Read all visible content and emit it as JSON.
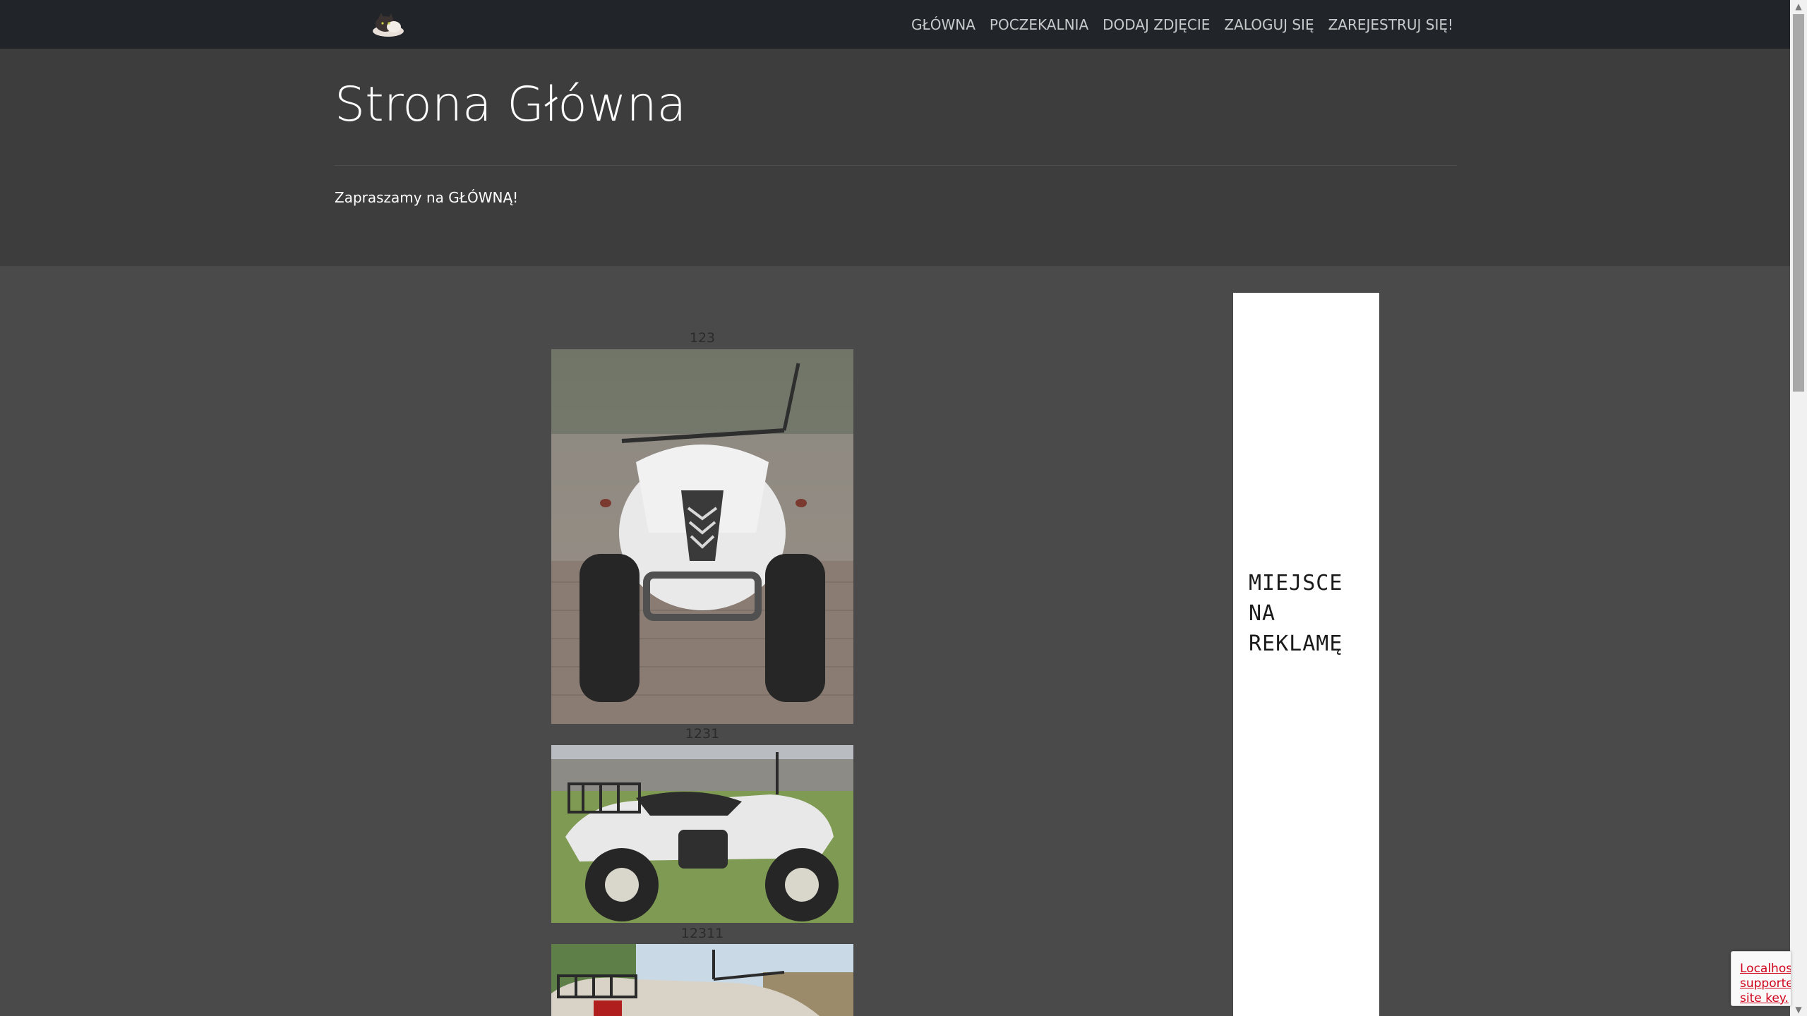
{
  "nav": {
    "links": [
      "GŁÓWNA",
      "POCZEKALNIA",
      "DODAJ ZDJĘCIE",
      "ZALOGUJ SIĘ",
      "ZAREJESTRUJ SIĘ!"
    ]
  },
  "header": {
    "title": "Strona Główna",
    "lead": "Zapraszamy na GŁÓWNĄ!"
  },
  "feed": {
    "items": [
      {
        "label": "123"
      },
      {
        "label": "1231"
      },
      {
        "label": "12311"
      }
    ]
  },
  "ad": {
    "text": "MIEJSCE\nNA\nREKLAMĘ"
  },
  "recaptcha": {
    "text": "Localhost\nsupported\nsite key."
  },
  "colors": {
    "navbar": "#212529",
    "jumbotron": "#3d3d3d",
    "page_bg": "#4a4a4a",
    "recaptcha_error": "#d0021b"
  }
}
